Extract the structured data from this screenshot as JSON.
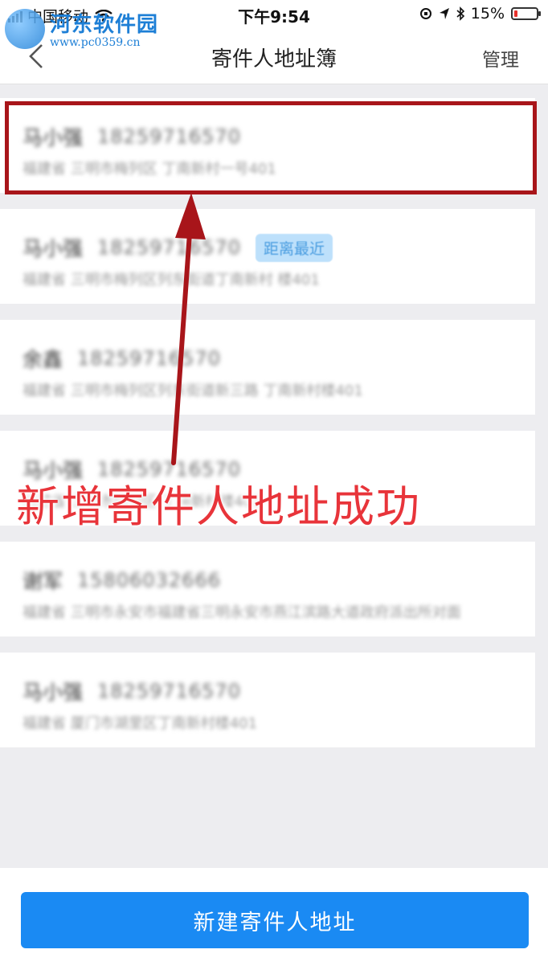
{
  "status_bar": {
    "carrier": "中国移动",
    "time": "下午9:54",
    "battery": "15%"
  },
  "watermark": {
    "title": "河东软件园",
    "url": "www.pc0359.cn"
  },
  "nav": {
    "title": "寄件人地址簿",
    "manage_label": "管理"
  },
  "addresses": [
    {
      "name": "马小强",
      "phone": "18259716570",
      "address": "福建省 三明市梅列区 丁南新村一号401"
    },
    {
      "name": "马小强",
      "phone": "18259716570",
      "address": "福建省 三明市梅列区列东街道丁南新村 楼401",
      "badge": "距离最近"
    },
    {
      "name": "余鑫",
      "phone": "18259716570",
      "address": "福建省 三明市梅列区列东街道新三路 丁南新村楼401"
    },
    {
      "name": "马小强",
      "phone": "18259716570",
      "address": "福建省 三明市梅列区 丁南新村楼401"
    },
    {
      "name": "谢军",
      "phone": "15806032666",
      "address": "福建省 三明市永安市福建省三明永安市燕江滨路大道政府派出所对面"
    },
    {
      "name": "马小强",
      "phone": "18259716570",
      "address": "福建省 厦门市湖里区丁南新村楼401"
    }
  ],
  "annotation": {
    "text": "新增寄件人地址成功"
  },
  "bottom": {
    "new_address_label": "新建寄件人地址"
  },
  "colors": {
    "accent": "#1a8af3",
    "highlight": "#a8151a",
    "annotation": "#e8343a",
    "badge_bg": "#bde0fb"
  }
}
